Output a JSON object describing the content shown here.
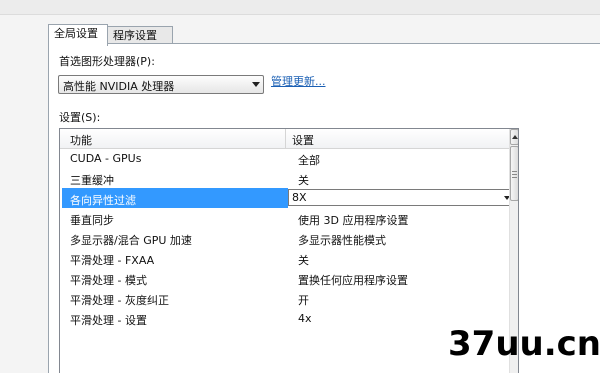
{
  "tabs": [
    "全局设置",
    "程序设置"
  ],
  "gpu": {
    "label": "首选图形处理器(P):",
    "selected": "高性能 NVIDIA 处理器",
    "manage_link": "管理更新..."
  },
  "settings": {
    "label": "设置(S):",
    "columns": [
      "功能",
      "设置"
    ],
    "rows": [
      {
        "feature": "CUDA - GPUs",
        "value": "全部"
      },
      {
        "feature": "三重缓冲",
        "value": "关"
      },
      {
        "feature": "各向异性过滤",
        "value": "8X",
        "selected": true
      },
      {
        "feature": "垂直同步",
        "value": "使用 3D 应用程序设置"
      },
      {
        "feature": "多显示器/混合 GPU 加速",
        "value": "多显示器性能模式"
      },
      {
        "feature": "平滑处理 - FXAA",
        "value": "关"
      },
      {
        "feature": "平滑处理 - 模式",
        "value": "置换任何应用程序设置"
      },
      {
        "feature": "平滑处理 - 灰度纠正",
        "value": "开"
      },
      {
        "feature": "平滑处理 - 设置",
        "value": "4x"
      }
    ]
  },
  "watermark": "37uu.cn"
}
